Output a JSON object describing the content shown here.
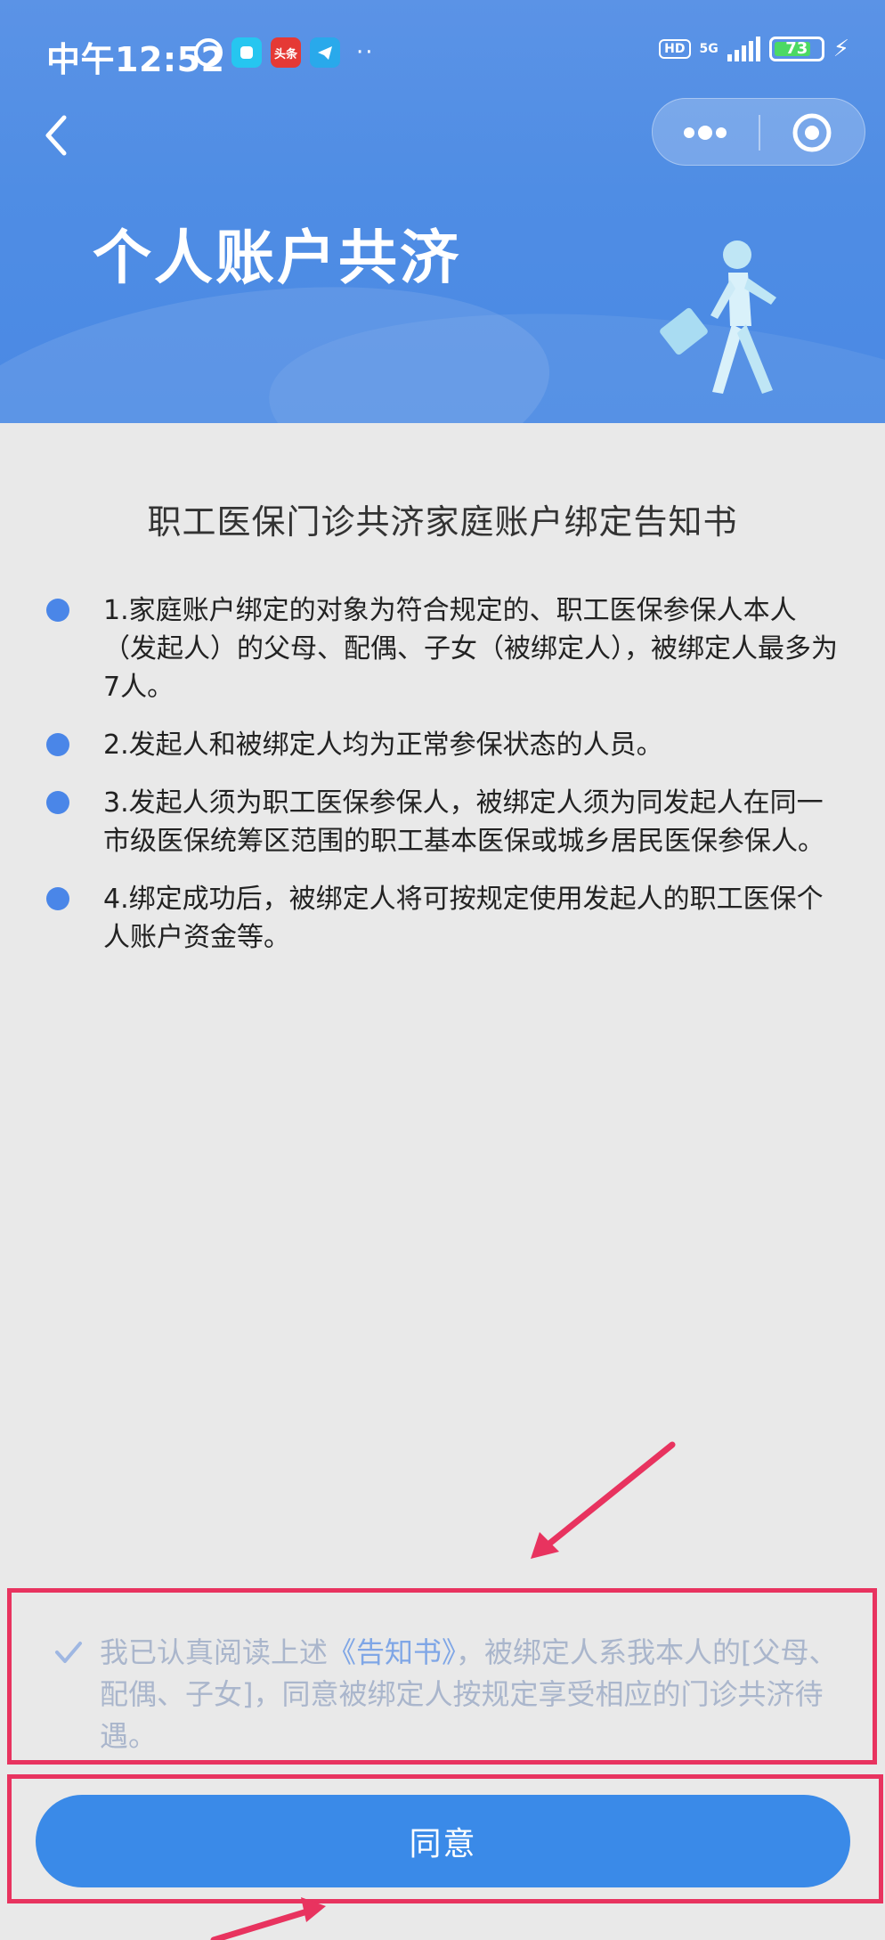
{
  "status_bar": {
    "time": "中午12:52",
    "notification_icons": [
      "alarm-icon",
      "app-icon",
      "toutiao-icon",
      "telegram-icon"
    ],
    "toutiao_label": "头条",
    "more": "··",
    "hd": "HD",
    "network": "5G",
    "battery": "73"
  },
  "header": {
    "title": "个人账户共济"
  },
  "notice": {
    "title": "职工医保门诊共济家庭账户绑定告知书",
    "items": [
      "1.家庭账户绑定的对象为符合规定的、职工医保参保人本人（发起人）的父母、配偶、子女（被绑定人），被绑定人最多为7人。",
      "2.发起人和被绑定人均为正常参保状态的人员。",
      "3.发起人须为职工医保参保人，被绑定人须为同发起人在同一市级医保统筹区范围的职工基本医保或城乡居民医保参保人。",
      "4.绑定成功后，被绑定人将可按规定使用发起人的职工医保个人账户资金等。"
    ]
  },
  "agreement": {
    "prefix": "我已认真阅读上述",
    "link": "《告知书》",
    "suffix": "，被绑定人系我本人的[父母、配偶、子女]，同意被绑定人按规定享受相应的门诊共济待遇。",
    "checked": true
  },
  "agree_button": "同意",
  "colors": {
    "header_blue": "#4f8de4",
    "button_blue": "#3a8ae8",
    "bullet_blue": "#4a86e8",
    "annotation_red": "#e8335f"
  }
}
